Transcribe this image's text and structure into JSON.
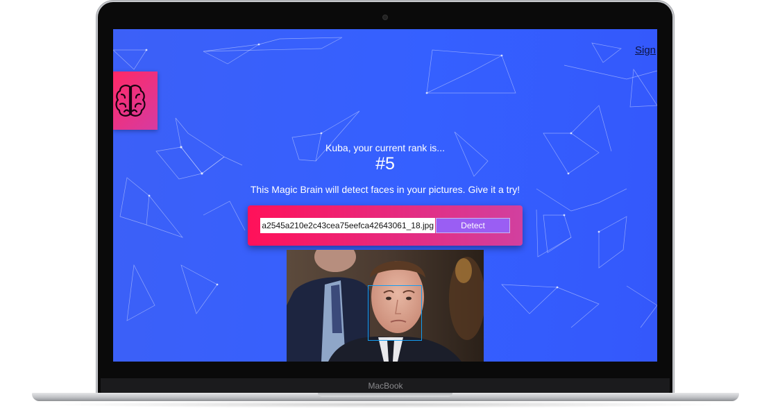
{
  "device": {
    "label": "MacBook"
  },
  "header": {
    "signout_label": "Sign"
  },
  "logo": {
    "icon": "brain-icon"
  },
  "rank": {
    "intro_text": "Kuba, your current rank is...",
    "value": "#5"
  },
  "description": "This Magic Brain will detect faces in your pictures. Give it a try!",
  "image_form": {
    "url_value": "a2545a210e2c43cea75eefca42643061_18.jpg",
    "detect_label": "Detect"
  },
  "colors": {
    "background": "#3560ff",
    "form_gradient_start": "#ff1159",
    "form_gradient_end": "#d1409f",
    "button": "#9a5ef3",
    "face_box": "#149df2"
  }
}
